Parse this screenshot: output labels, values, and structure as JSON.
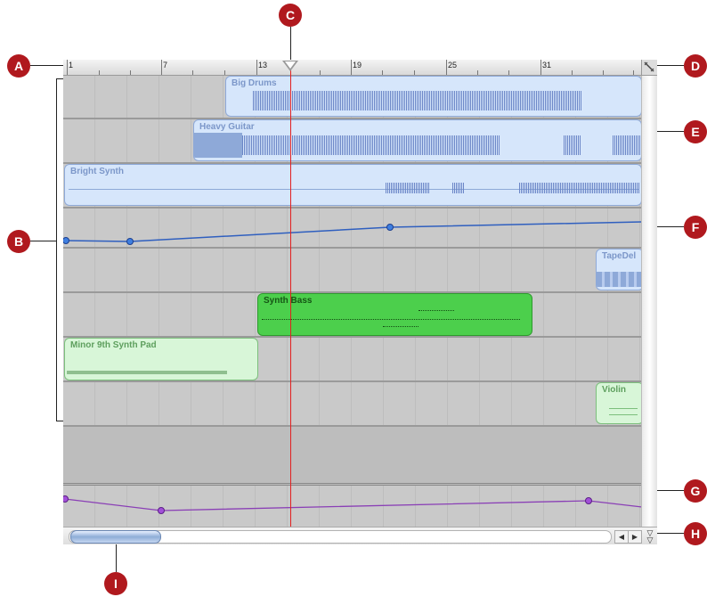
{
  "callouts": [
    "A",
    "B",
    "C",
    "D",
    "E",
    "F",
    "G",
    "H",
    "I"
  ],
  "ruler": {
    "labels": [
      "1",
      "7",
      "13",
      "19",
      "25",
      "31"
    ]
  },
  "regions": {
    "big_drums": "Big Drums",
    "heavy_guitar": "Heavy Guitar",
    "bright_synth": "Bright Synth",
    "tape_delay": "TapeDel",
    "synth_bass": "Synth Bass",
    "synth_pad": "Minor 9th Synth Pad",
    "violin": "Violin"
  },
  "colors": {
    "callout": "#b0191e",
    "playhead": "#e22020",
    "audio_region": "#d6e6fb",
    "midi_region": "#d8f6d8",
    "midi_selected": "#4ccf4c",
    "automation_blue": "#2f5fbf",
    "automation_purple": "#8a3fb6"
  },
  "icons": {
    "playhead": "playhead-triangle-icon",
    "ruler_zoom": "ruler-zoom-icon",
    "scroll_left": "arrow-left-icon",
    "scroll_right": "arrow-right-icon",
    "zoom": "zoom-updown-icon"
  }
}
